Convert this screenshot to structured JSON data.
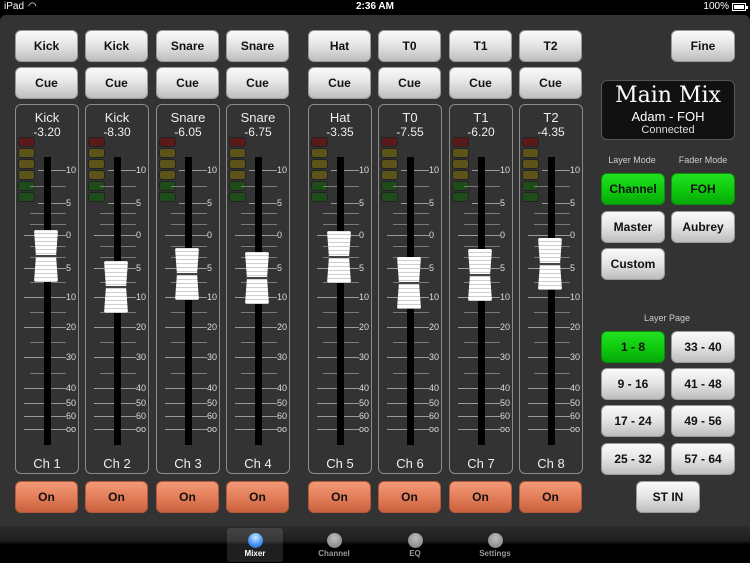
{
  "status_bar": {
    "device": "iPad",
    "time": "2:36 AM",
    "battery": "100%"
  },
  "channels": [
    {
      "name_button": "Kick",
      "cue_label": "Cue",
      "name": "Kick",
      "value": "-3.20",
      "ch_label": "Ch 1",
      "on_label": "On",
      "fader_db": -3.2
    },
    {
      "name_button": "Kick",
      "cue_label": "Cue",
      "name": "Kick",
      "value": "-8.30",
      "ch_label": "Ch 2",
      "on_label": "On",
      "fader_db": -8.3
    },
    {
      "name_button": "Snare",
      "cue_label": "Cue",
      "name": "Snare",
      "value": "-6.05",
      "ch_label": "Ch 3",
      "on_label": "On",
      "fader_db": -6.05
    },
    {
      "name_button": "Snare",
      "cue_label": "Cue",
      "name": "Snare",
      "value": "-6.75",
      "ch_label": "Ch 4",
      "on_label": "On",
      "fader_db": -6.75
    },
    {
      "name_button": "Hat",
      "cue_label": "Cue",
      "name": "Hat",
      "value": "-3.35",
      "ch_label": "Ch 5",
      "on_label": "On",
      "fader_db": -3.35
    },
    {
      "name_button": "T0",
      "cue_label": "Cue",
      "name": "T0",
      "value": "-7.55",
      "ch_label": "Ch 6",
      "on_label": "On",
      "fader_db": -7.55
    },
    {
      "name_button": "T1",
      "cue_label": "Cue",
      "name": "T1",
      "value": "-6.20",
      "ch_label": "Ch 7",
      "on_label": "On",
      "fader_db": -6.2
    },
    {
      "name_button": "T2",
      "cue_label": "Cue",
      "name": "T2",
      "value": "-4.35",
      "ch_label": "Ch 8",
      "on_label": "On",
      "fader_db": -4.35
    }
  ],
  "scale_labels": [
    "10",
    "5",
    "0",
    "5",
    "10",
    "20",
    "30",
    "40",
    "50",
    "60",
    "oo"
  ],
  "meter_colors": [
    "#5a1a1a",
    "#5c5418",
    "#5c5418",
    "#5c5418",
    "#1f4d1a",
    "#1f4d1a"
  ],
  "right_panel": {
    "fine_label": "Fine",
    "main_mix": {
      "title": "Main Mix",
      "subtitle": "Adam - FOH",
      "status": "Connected"
    },
    "layer_mode_caption": "Layer Mode",
    "fader_mode_caption": "Fader Mode",
    "layer_mode": [
      "Channel",
      "Master",
      "Custom"
    ],
    "fader_mode": [
      "FOH",
      "Aubrey"
    ],
    "layer_page_caption": "Layer Page",
    "layer_pages": [
      "1 - 8",
      "33 - 40",
      "9 - 16",
      "41 - 48",
      "17 - 24",
      "49 - 56",
      "25 - 32",
      "57 - 64"
    ],
    "st_in_label": "ST IN",
    "active_layer_mode": "Channel",
    "active_fader_mode": "FOH",
    "active_layer_page": "1 - 8"
  },
  "tabs": [
    {
      "label": "Mixer",
      "active": true
    },
    {
      "label": "Channel",
      "active": false
    },
    {
      "label": "EQ",
      "active": false
    },
    {
      "label": "Settings",
      "active": false
    }
  ],
  "colors": {
    "active_green": "#12cc12",
    "on_orange": "#e47e5a",
    "tab_active_blue": "#3d8ef0"
  }
}
